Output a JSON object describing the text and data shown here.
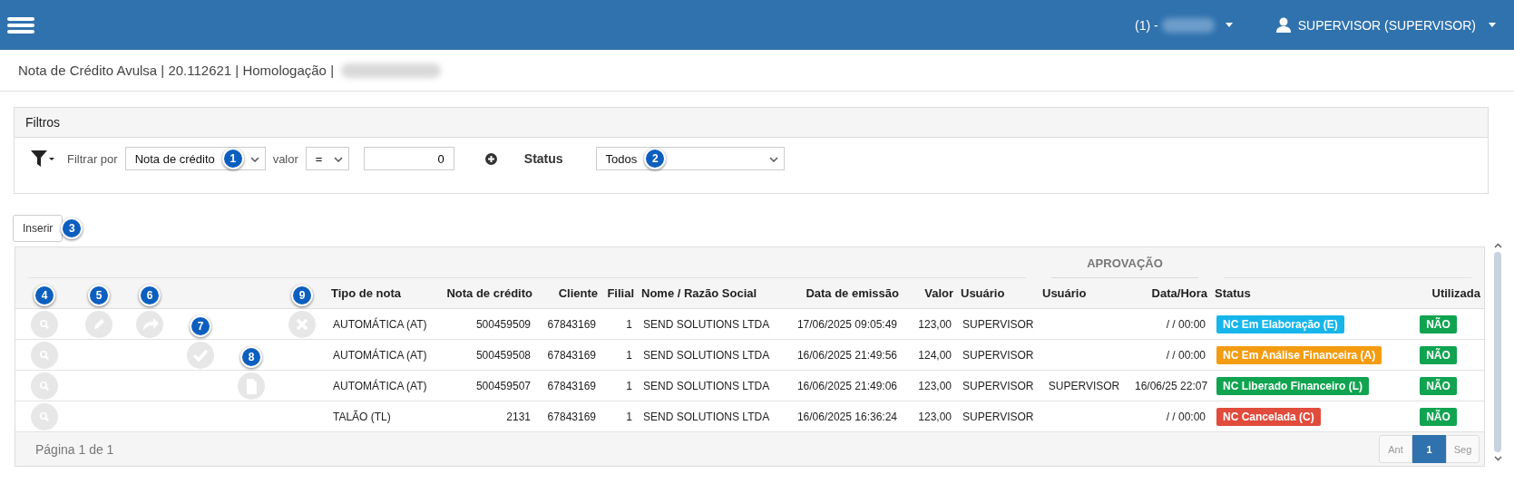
{
  "top_bar": {
    "company": "(1) -",
    "user": "SUPERVISOR (SUPERVISOR)"
  },
  "breadcrumb": "Nota de Crédito Avulsa | 20.112621 | Homologação |",
  "filters": {
    "title": "Filtros",
    "filter_label": "Filtrar por",
    "filter_field": {
      "value": "Nota de crédito",
      "marker": "1"
    },
    "operator_label": "valor",
    "operator": "=",
    "value": "0",
    "status_label": "Status",
    "status": {
      "value": "Todos",
      "marker": "2"
    }
  },
  "insert_button": {
    "label": "Inserir",
    "marker": "3"
  },
  "table": {
    "group_header": "APROVAÇÃO",
    "columns": [
      "Tipo de nota",
      "Nota de crédito",
      "Cliente",
      "Filial",
      "Nome / Razão Social",
      "Data de emissão",
      "Valor",
      "Usuário",
      "Usuário",
      "Data/Hora",
      "Status",
      "Utilizada"
    ],
    "rows": [
      {
        "actions": [
          {
            "kind": "view",
            "marker": "4"
          },
          {
            "kind": "edit",
            "marker": "5"
          },
          {
            "kind": "forward",
            "marker": "6"
          },
          {
            "kind": "cancel",
            "marker": "9"
          }
        ],
        "cells": [
          "AUTOMÁTICA (AT)",
          "500459509",
          "67843169",
          "1",
          "SEND SOLUTIONS LTDA",
          "17/06/2025 09:05:49",
          "123,00",
          "SUPERVISOR",
          "",
          "/ / 00:00"
        ],
        "status": {
          "label": "NC Em Elaboração (E)",
          "color": "#17b6ea"
        },
        "used": {
          "label": "NÃO",
          "color": "#10a450"
        }
      },
      {
        "actions": [
          {
            "kind": "view"
          },
          {
            "kind": "approve",
            "marker": "7"
          }
        ],
        "cells": [
          "AUTOMÁTICA (AT)",
          "500459508",
          "67843169",
          "1",
          "SEND SOLUTIONS LTDA",
          "16/06/2025 21:49:56",
          "124,00",
          "SUPERVISOR",
          "",
          "/ / 00:00"
        ],
        "status": {
          "label": "NC Em Análise Financeira (A)",
          "color": "#f39c12"
        },
        "used": {
          "label": "NÃO",
          "color": "#10a450"
        }
      },
      {
        "actions": [
          {
            "kind": "view"
          },
          {
            "kind": "document",
            "marker": "8"
          }
        ],
        "cells": [
          "AUTOMÁTICA (AT)",
          "500459507",
          "67843169",
          "1",
          "SEND SOLUTIONS LTDA",
          "16/06/2025 21:49:06",
          "123,00",
          "SUPERVISOR",
          "SUPERVISOR",
          "16/06/25 22:07"
        ],
        "status": {
          "label": "NC Liberado Financeiro (L)",
          "color": "#10a450"
        },
        "used": {
          "label": "NÃO",
          "color": "#10a450"
        }
      },
      {
        "actions": [
          {
            "kind": "view"
          }
        ],
        "cells": [
          "TALÃO (TL)",
          "2131",
          "67843169",
          "1",
          "SEND SOLUTIONS LTDA",
          "16/06/2025 16:36:24",
          "123,00",
          "SUPERVISOR",
          "",
          "/ / 00:00"
        ],
        "status": {
          "label": "NC Cancelada (C)",
          "color": "#e04b3c"
        },
        "used": {
          "label": "NÃO",
          "color": "#10a450"
        }
      }
    ]
  },
  "pagination": {
    "info": "Página 1 de 1",
    "pages": [
      {
        "label": "Ant",
        "selected": false,
        "disabled": true
      },
      {
        "label": "1",
        "selected": true,
        "disabled": false
      },
      {
        "label": "Seg",
        "selected": false,
        "disabled": true
      }
    ]
  }
}
